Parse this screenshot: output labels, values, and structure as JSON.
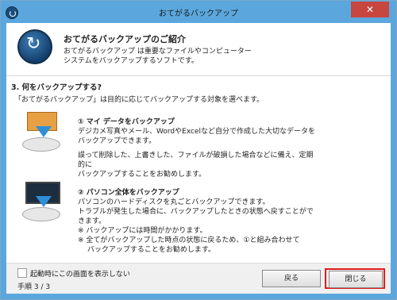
{
  "window": {
    "title": "おてがるバックアップ",
    "close_glyph": "✕"
  },
  "intro": {
    "heading": "おてがるバックアップのご紹介",
    "line1": "おてがるバックアップ は重要なファイルやコンピューター",
    "line2": "システムをバックアップするソフトです。"
  },
  "section": {
    "heading": "3. 何をバックアップする?",
    "subtext": "「おてがるバックアップ」は目的に応じてバックアップする対象を選べます。"
  },
  "options": [
    {
      "title": "① マイ データをバックアップ",
      "lines": [
        "デジカメ写真やメール、WordやExcelなど自分で作成した大切なデータを",
        "バックアップできます。",
        "",
        "誤って削除した、上書きした、ファイルが破損した場合などに備え、定期的に",
        "バックアップすることをお勧めします。"
      ],
      "icon": "my-data-backup-icon"
    },
    {
      "title": "② パソコン全体をバックアップ",
      "lines": [
        "パソコンのハードディスクを丸ごとバックアップできます。",
        "トラブルが発生した場合に、バックアップしたときの状態へ戻すことができます。",
        "※ バックアップには時間がかかります。",
        "※ 全てがバックアップした時点の状態に戻るため、①と組み合わせて",
        "　 バックアップすることをお勧めします。"
      ],
      "icon": "pc-backup-icon"
    }
  ],
  "footer": {
    "checkbox_label": "起動時にこの画面を表示しない",
    "step": "手順 3 / 3",
    "back_label": "戻る",
    "close_label": "閉じる"
  }
}
